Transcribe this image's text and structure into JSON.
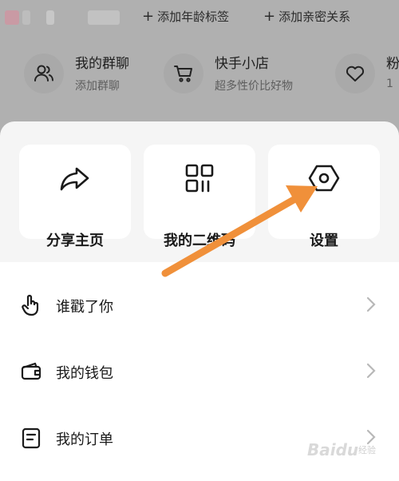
{
  "profile_tags": {
    "add_age_tag": "添加年龄标签",
    "add_relation": "添加亲密关系",
    "plus_icon": "plus-icon"
  },
  "quick_entries": [
    {
      "title": "我的群聊",
      "subtitle": "添加群聊",
      "icon": "group-chat-icon"
    },
    {
      "title": "快手小店",
      "subtitle": "超多性价比好物",
      "icon": "shopping-cart-icon"
    },
    {
      "title": "粉",
      "subtitle": "1",
      "icon": "fan-heart-icon"
    }
  ],
  "cards": [
    {
      "label": "分享主页",
      "icon": "share-icon"
    },
    {
      "label": "我的二维码",
      "icon": "qr-code-icon"
    },
    {
      "label": "设置",
      "icon": "settings-icon"
    }
  ],
  "menu": [
    {
      "label": "谁戳了你",
      "icon": "poke-hand-icon"
    },
    {
      "label": "我的钱包",
      "icon": "wallet-icon"
    },
    {
      "label": "我的订单",
      "icon": "order-icon"
    }
  ],
  "annotation": {
    "arrow_color": "#f0903a",
    "points_to": "设置"
  },
  "watermark": {
    "text": "Baidu",
    "sub": "经验"
  },
  "colors": {
    "overlay": "#b0b0b0",
    "sheet_bg": "#f5f5f5",
    "card_bg": "#ffffff"
  }
}
